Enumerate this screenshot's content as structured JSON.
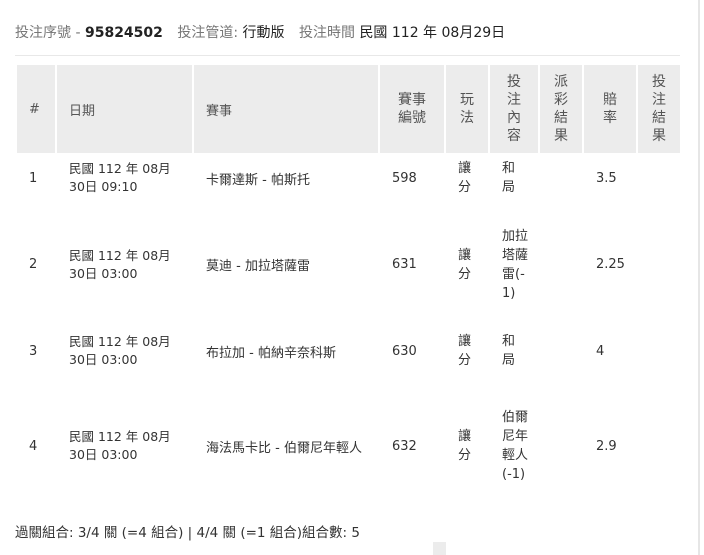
{
  "info": {
    "serial_label": "投注序號",
    "dash": "-",
    "serial_value": "95824502",
    "channel_label": "投注管道:",
    "channel_value": "行動版",
    "time_label": "投注時間",
    "time_value": "民國 112 年 08月29日"
  },
  "table": {
    "headers": [
      "#",
      "日期",
      "賽事",
      "賽事編號",
      "玩法",
      "投注內容",
      "派彩結果",
      "賠率",
      "投注結果"
    ],
    "rows": [
      {
        "no": "1",
        "date1": "民國 112 年 08月",
        "date2": "30日 09:10",
        "match": "卡爾達斯 - 帕斯托",
        "id": "598",
        "play": "讓分",
        "bet": "和局",
        "payout": "",
        "odds": "3.5",
        "result": ""
      },
      {
        "no": "2",
        "date1": "民國 112 年 08月",
        "date2": "30日 03:00",
        "match": "莫迪 - 加拉塔薩雷",
        "id": "631",
        "play": "讓分",
        "bet": "加拉塔薩雷(-1)",
        "payout": "",
        "odds": "2.25",
        "result": ""
      },
      {
        "no": "3",
        "date1": "民國 112 年 08月",
        "date2": "30日 03:00",
        "match": "布拉加 - 帕納辛奈科斯",
        "id": "630",
        "play": "讓分",
        "bet": "和局",
        "payout": "",
        "odds": "4",
        "result": ""
      },
      {
        "no": "4",
        "date1": "民國 112 年 08月",
        "date2": "30日 03:00",
        "match": "海法馬卡比 - 伯爾尼年輕人",
        "id": "632",
        "play": "讓分",
        "bet": "伯爾尼年輕人(-1)",
        "payout": "",
        "odds": "2.9",
        "result": ""
      }
    ]
  },
  "footer": {
    "text": "過關組合: 3/4 關 (=4 組合) | 4/4 關 (=1 組合)組合數: 5"
  }
}
